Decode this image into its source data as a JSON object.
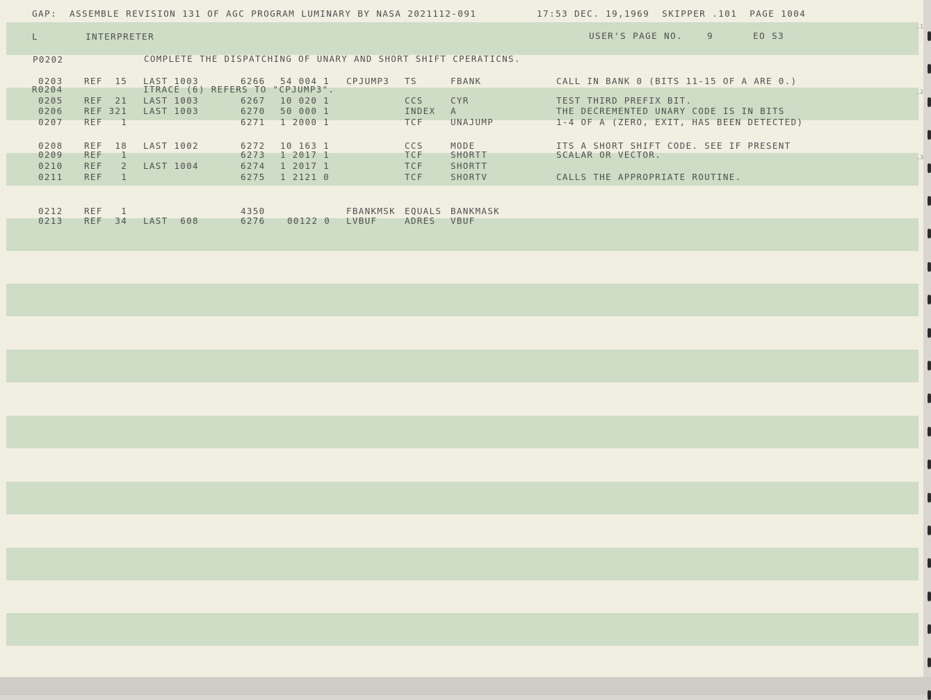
{
  "header": {
    "left": "GAP:  ASSEMBLE REVISION 131 OF AGC PROGRAM LUMINARY BY NASA 2021112-091",
    "right": "17:53 DEC. 19,1969  SKIPPER .101  PAGE 1004"
  },
  "subheader": {
    "log_letter": "L",
    "section": "INTERPRETER",
    "users_page_label": "USER'S PAGE NO.",
    "users_page_number": "9",
    "code": "EO S3"
  },
  "page_comment": {
    "id": "P0202",
    "text": "COMPLETE THE DISPATCHING OF UNARY AND SHORT SHIFT CPERATICNS."
  },
  "listing": [
    {
      "id": "0203",
      "ref": "REF  15",
      "last": "LAST 1003",
      "addr": "6266",
      "code": "54 004 1",
      "label": "CPJUMP3",
      "op": "TS",
      "operand": "FBANK",
      "comment": "CALL IN BANK 0 (BITS 11-15 OF A ARE 0.)"
    },
    {
      "id": "R0204",
      "ref": "",
      "last": "ITRACE (6) REFERS TO \"CPJUMP3\".",
      "addr": "",
      "code": "",
      "label": "",
      "op": "",
      "operand": "",
      "comment": ""
    },
    {
      "id": "0205",
      "ref": "REF  21",
      "last": "LAST 1003",
      "addr": "6267",
      "code": "10 020 1",
      "label": "",
      "op": "CCS",
      "operand": "CYR",
      "comment": "TEST THIRD PREFIX BIT."
    },
    {
      "id": "0206",
      "ref": "REF 321",
      "last": "LAST 1003",
      "addr": "6270",
      "code": "50 000 1",
      "label": "",
      "op": "INDEX",
      "operand": "A",
      "comment": "THE DECREMENTED UNARY CODE IS IN BITS"
    },
    {
      "id": "0207",
      "ref": "REF   1",
      "last": "",
      "addr": "6271",
      "code": "1 2000 1",
      "label": "",
      "op": "TCF",
      "operand": "UNAJUMP",
      "comment": "1-4 OF A (ZERO, EXIT, HAS BEEN DETECTED)"
    },
    {
      "id": "0208",
      "ref": "REF  18",
      "last": "LAST 1002",
      "addr": "6272",
      "code": "10 163 1",
      "label": "",
      "op": "CCS",
      "operand": "MODE",
      "comment": "ITS A SHORT SHIFT CODE. SEE IF PRESENT"
    },
    {
      "id": "0209",
      "ref": "REF   1",
      "last": "",
      "addr": "6273",
      "code": "1 2017 1",
      "label": "",
      "op": "TCF",
      "operand": "SHORTT",
      "comment": "SCALAR OR VECTOR."
    },
    {
      "id": "0210",
      "ref": "REF   2",
      "last": "LAST 1004",
      "addr": "6274",
      "code": "1 2017 1",
      "label": "",
      "op": "TCF",
      "operand": "SHORTT",
      "comment": ""
    },
    {
      "id": "0211",
      "ref": "REF   1",
      "last": "",
      "addr": "6275",
      "code": "1 2121 0",
      "label": "",
      "op": "TCF",
      "operand": "SHORTV",
      "comment": "CALLS THE APPROPRIATE ROUTINE."
    },
    {
      "id": "0212",
      "ref": "REF   1",
      "last": "",
      "addr": "4350",
      "code": "",
      "label": "FBANKMSK",
      "op": "EQUALS",
      "operand": "BANKMASK",
      "comment": ""
    },
    {
      "id": "0213",
      "ref": "REF  34",
      "last": "LAST  608",
      "addr": "6276",
      "code": "00122 0",
      "label": "LVBUF",
      "op": "ADRES",
      "operand": "VBUF",
      "comment": ""
    }
  ],
  "margin_marks": [
    "..1",
    "..2",
    "..3"
  ]
}
